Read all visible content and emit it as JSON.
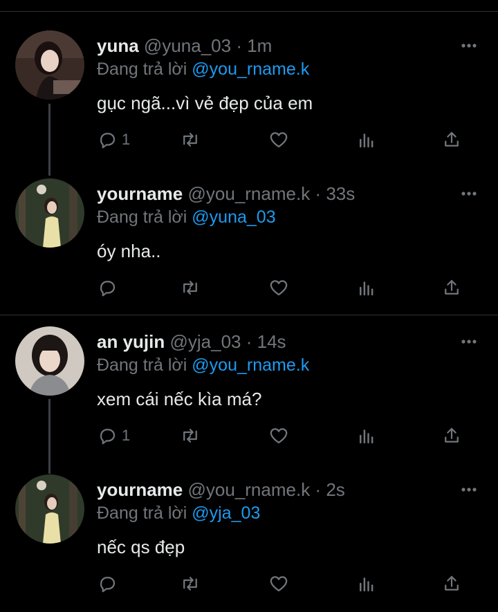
{
  "tweets": [
    {
      "name": "yuna",
      "handle": "@yuna_03",
      "time": "· 1m",
      "reply_prefix": "Đang trả lời",
      "reply_to": "@you_rname.k",
      "text": "gục ngã...vì vẻ đẹp của em",
      "reply_count": "1"
    },
    {
      "name": "yourname",
      "handle": "@you_rname.k",
      "time": "· 33s",
      "reply_prefix": "Đang trả lời",
      "reply_to": "@yuna_03",
      "text": "óy nha..",
      "reply_count": ""
    },
    {
      "name": "an yujin",
      "handle": "@yja_03",
      "time": "· 14s",
      "reply_prefix": "Đang trả lời",
      "reply_to": "@you_rname.k",
      "text": "xem cái nếc kìa má?",
      "reply_count": "1"
    },
    {
      "name": "yourname",
      "handle": "@you_rname.k",
      "time": "· 2s",
      "reply_prefix": "Đang trả lời",
      "reply_to": "@yja_03",
      "text": "nếc qs đẹp",
      "reply_count": ""
    }
  ],
  "icons": [
    "more-icon",
    "reply-icon",
    "retweet-icon",
    "like-icon",
    "views-icon",
    "share-icon"
  ],
  "colors": {
    "background": "#000000",
    "text": "#e7e9ea",
    "muted": "#71767b",
    "link": "#1d9bf0",
    "border": "#2f3336"
  }
}
